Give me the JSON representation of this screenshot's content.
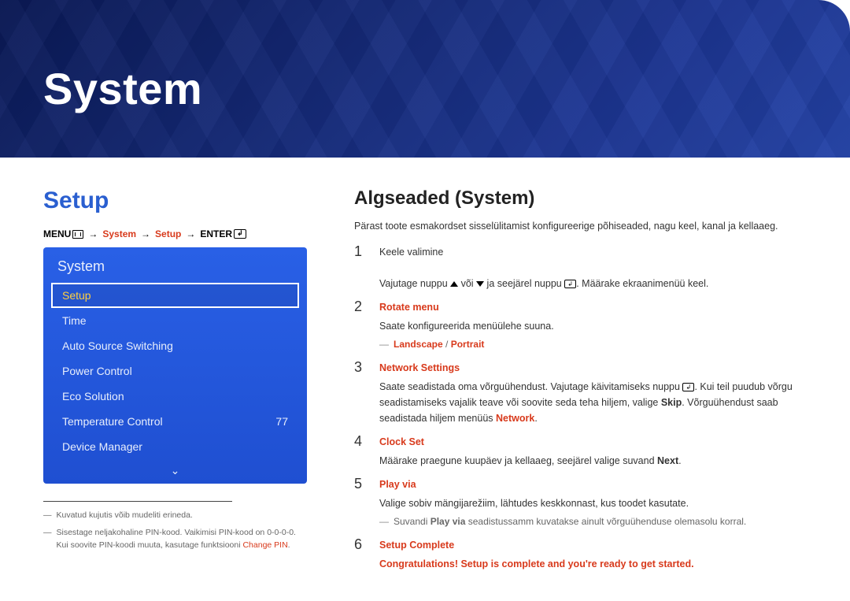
{
  "banner": {
    "title": "System"
  },
  "left": {
    "setup_title": "Setup",
    "breadcrumb": {
      "menu": "MENU",
      "arrow": "→",
      "system": "System",
      "setup": "Setup",
      "enter": "ENTER"
    },
    "panel": {
      "title": "System",
      "items": [
        {
          "label": "Setup",
          "active": true
        },
        {
          "label": "Time"
        },
        {
          "label": "Auto Source Switching"
        },
        {
          "label": "Power Control"
        },
        {
          "label": "Eco Solution"
        },
        {
          "label": "Temperature Control",
          "value": "77"
        },
        {
          "label": "Device Manager"
        }
      ]
    },
    "footnotes": [
      {
        "text": "Kuvatud kujutis võib mudeliti erineda."
      },
      {
        "text": "Sisestage neljakohaline PIN-kood. Vaikimisi PIN-kood on 0-0-0-0.",
        "extra": "Kui soovite PIN-koodi muuta, kasutage funktsiooni ",
        "red": "Change PIN",
        "tail": "."
      }
    ]
  },
  "right": {
    "title": "Algseaded (System)",
    "intro": "Pärast toote esmakordset sisselülitamist konfigureerige põhiseaded, nagu keel, kanal ja kellaaeg.",
    "steps": {
      "s1": {
        "line1": "Keele valimine",
        "line2_a": "Vajutage nuppu ",
        "line2_b": " või ",
        "line2_c": " ja seejärel nuppu ",
        "line2_d": ". Määrake ekraanimenüü keel."
      },
      "s2": {
        "head": "Rotate menu",
        "line": "Saate konfigureerida menüülehe suuna.",
        "sub_label": "Landscape",
        "sub_sep": " / ",
        "sub_label2": "Portrait"
      },
      "s3": {
        "head": "Network Settings",
        "line_a": "Saate seadistada oma võrguühendust. Vajutage käivitamiseks nuppu ",
        "line_b": ". Kui teil puudub võrgu seadistamiseks vajalik teave või soovite seda teha hiljem, valige ",
        "skip": "Skip",
        "line_c": ". Võrguühendust saab seadistada hiljem menüüs ",
        "network": "Network",
        "tail": "."
      },
      "s4": {
        "head": "Clock Set",
        "line_a": "Määrake praegune kuupäev ja kellaaeg, seejärel valige suvand ",
        "next": "Next",
        "tail": "."
      },
      "s5": {
        "head": "Play via",
        "line": "Valige sobiv mängijarežiim, lähtudes keskkonnast, kus toodet kasutate.",
        "sub_a": "Suvandi ",
        "sub_b": "Play via",
        "sub_c": " seadistussamm kuvatakse ainult võrguühenduse olemasolu korral."
      },
      "s6": {
        "head": "Setup Complete",
        "line": "Congratulations! Setup is complete and you're ready to get started."
      }
    }
  }
}
